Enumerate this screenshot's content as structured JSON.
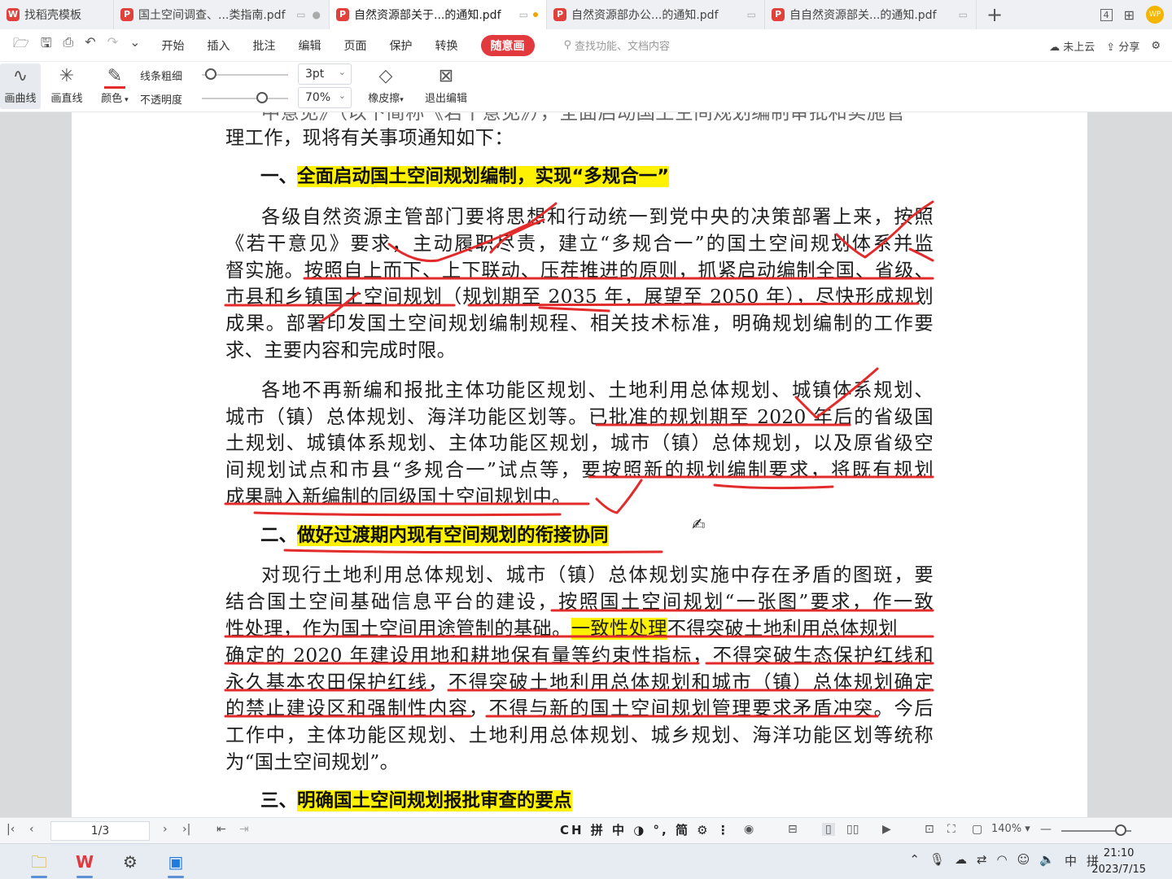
{
  "tabs": [
    {
      "label": "找稻壳模板",
      "active": false
    },
    {
      "label": "国土空间调查、...类指南.pdf",
      "active": false
    },
    {
      "label": "自然资源部关于...的通知.pdf",
      "active": true
    },
    {
      "label": "自然资源部办公...的通知.pdf",
      "active": false
    },
    {
      "label": "自自然资源部关...的通知.pdf",
      "active": false
    }
  ],
  "window": {
    "tab_count": "4",
    "user_badge": "WP"
  },
  "menu": {
    "items": [
      "开始",
      "插入",
      "批注",
      "编辑",
      "页面",
      "保护",
      "转换",
      "随意画"
    ],
    "search_placeholder": "查找功能、文档内容",
    "cloud": "未上云",
    "share": "分享"
  },
  "draw_toolbar": {
    "curve": "画曲线",
    "line": "画直线",
    "color": "颜色",
    "thickness_label": "线条粗细",
    "opacity_label": "不透明度",
    "thickness_value": "3pt",
    "opacity_value": "70%",
    "thickness_level": 0.1,
    "opacity_level": 0.7,
    "eraser": "橡皮擦",
    "exit": "退出编辑",
    "pen_color": "#e32b2b"
  },
  "document": {
    "top_partial": "中意见》（以下简称《若干意见》），全面启动国土空间规划编制审批和实施管",
    "l0": "理工作，现将有关事项通知如下：",
    "h1_num": "一、",
    "h1_text": "全面启动国土空间规划编制，实现“多规合一”",
    "p1": [
      "各级自然资源主管部门要将思想和行动统一到党中央的决策部署上来，按照",
      "《若干意见》要求，主动履职尽责，建立“多规合一”的国土空间规划体系并监",
      "督实施。按照自上而下、上下联动、压茬推进的原则，抓紧启动编制全国、省级、",
      "市县和乡镇国土空间规划（规划期至 2035 年，展望至 2050 年），尽快形成规划",
      "成果。部署印发国土空间规划编制规程、相关技术标准，明确规划编制的工作要",
      "求、主要内容和完成时限。"
    ],
    "p2": [
      "各地不再新编和报批主体功能区规划、土地利用总体规划、城镇体系规划、",
      "城市（镇）总体规划、海洋功能区划等。已批准的规划期至 2020 年后的省级国",
      "土规划、城镇体系规划、主体功能区规划，城市（镇）总体规划，以及原省级空",
      "间规划试点和市县“多规合一”试点等，要按照新的规划编制要求，将既有规划",
      "成果融入新编制的同级国土空间规划中。"
    ],
    "h2_num": "二、",
    "h2_text": "做好过渡期内现有空间规划的衔接协同",
    "p3": [
      "对现行土地利用总体规划、城市（镇）总体规划实施中存在矛盾的图斑，要",
      "结合国土空间基础信息平台的建设，按照国土空间规划“一张图”要求，作一致"
    ],
    "p3_l2a": "性处理，作为国土空间用途管制的基础。",
    "p3_l2b": "一致性处理",
    "p3_l2c": "不得突破土地利用总体规划",
    "p3b": [
      "确定的 2020 年建设用地和耕地保有量等约束性指标，不得突破生态保护红线和",
      "永久基本农田保护红线，不得突破土地利用总体规划和城市（镇）总体规划确定",
      "的禁止建设区和强制性内容，不得与新的国土空间规划管理要求矛盾冲突。今后",
      "工作中，主体功能区规划、土地利用总体规划、城乡规划、海洋功能区划等统称",
      "为“国土空间规划”。"
    ],
    "h3_num": "三、",
    "h3_text": "明确国土空间规划报批审查的要点"
  },
  "statusbar": {
    "page": "1/3",
    "ime": "CH 拼 中 ◑ °, 简 ⚙ ⋮",
    "zoom": "140%",
    "zoom_level": 0.85
  },
  "taskbar": {
    "input_mode": "中",
    "ime_mode": "拼",
    "time": "21:10",
    "date": "2023/7/15"
  },
  "icons": {
    "pdf": "pdf-icon",
    "open": "folder-open-icon",
    "save": "save-icon",
    "print": "print-icon",
    "undo": "undo-icon",
    "redo": "redo-icon"
  }
}
